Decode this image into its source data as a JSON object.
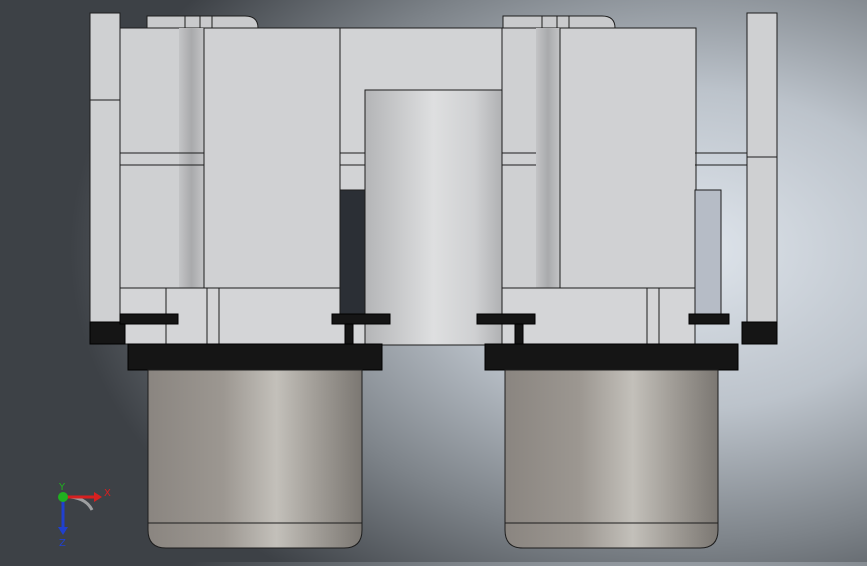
{
  "viewport": {
    "colors": {
      "body": "#d2d3d5",
      "edge": "#1d1d1d",
      "dark_slot": "#2b2f35",
      "black_band": "#151515",
      "axis_x": "#d62020",
      "axis_y": "#20b020",
      "axis_z": "#2040d0"
    }
  },
  "triad": {
    "x_label": "X",
    "y_label": "Y",
    "z_label": "Z"
  }
}
